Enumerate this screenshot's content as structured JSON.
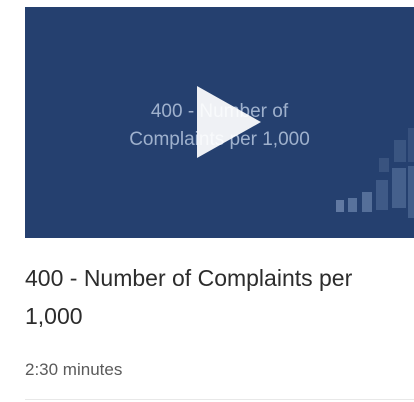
{
  "video": {
    "thumbnail_line1": "400 - Number of",
    "thumbnail_line2": "Complaints per 1,000",
    "title": "400 - Number of Complaints per 1,000",
    "duration": "2:30 minutes",
    "play_icon": "play-icon",
    "colors": {
      "thumbnail_bg": "#25406f",
      "thumbnail_text": "#9fb1cd",
      "title_text": "#2c2c2c",
      "duration_text": "#5a5a5a"
    }
  }
}
